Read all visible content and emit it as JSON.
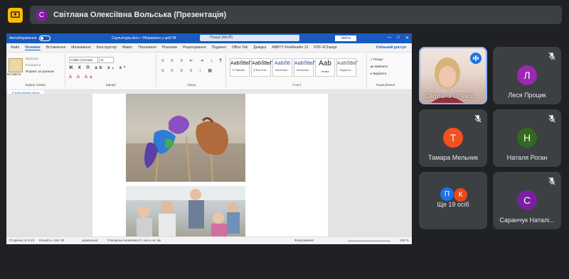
{
  "presenter": {
    "initial": "С",
    "name": "Світлана Олексіївна Вольська (Презентація)"
  },
  "word": {
    "autosave": "Автозбереження",
    "doc_title": "Скульптура.docx • Збережено у цей ПК",
    "search_placeholder": "Пошук (Alt+Й)",
    "signin": "Увійти",
    "tabs": [
      "Файл",
      "Основне",
      "Вставлення",
      "Малювання",
      "Конструктор",
      "Макет",
      "Посилання",
      "Розсилки",
      "Рецензування",
      "Подання",
      "Office Tab",
      "Довідка",
      "ABBYY FineReader 12",
      "PDF-XChange"
    ],
    "active_tab": "Основне",
    "share": "Спільний доступ",
    "groups": [
      "Буфер обміну",
      "Шрифт",
      "Абзац",
      "Стилі",
      "Редагування"
    ],
    "paste": "Вставити",
    "clip_items": [
      "Вирізати",
      "Копіювати",
      "Формат за зразком"
    ],
    "font_name": "Calibri (Основн",
    "font_size": "11",
    "styles": [
      {
        "sample": "АаБбВвГ",
        "name": "¶ Звичай..."
      },
      {
        "sample": "АаБбВвГ",
        "name": "¶ Без інте..."
      },
      {
        "sample": "АаБбВ",
        "name": "Заголово..."
      },
      {
        "sample": "АаБбВвГ",
        "name": "Заголово..."
      },
      {
        "sample": "Aab",
        "name": "Назва"
      },
      {
        "sample": "АаБбВвГ",
        "name": "Підзагол..."
      }
    ],
    "editing": [
      "Пошук",
      "Замінити",
      "Виділити"
    ],
    "doc_tab": "Скульптура.docx",
    "status": {
      "page": "Сторінка 10 із 10",
      "words": "Кількість слів: 30",
      "lang": "українська",
      "access": "Спеціальні можливості: шось не так",
      "focus": "Фокусування",
      "zoom": "100 %"
    }
  },
  "participants": [
    {
      "name": "Світлана Олексі...",
      "type": "camera"
    },
    {
      "name": "Леся Процик",
      "initial": "Л",
      "color": "#9c27b0"
    },
    {
      "name": "Тамара Мельник",
      "initial": "Т",
      "color": "#f4511e"
    },
    {
      "name": "Наталя Роган",
      "initial": "Н",
      "color": "#33691e"
    },
    {
      "name": "Ще 19 осіб",
      "initials": [
        "П",
        "К"
      ],
      "colors": [
        "#1a73e8",
        "#e64a19"
      ]
    },
    {
      "name": "Саранчук Наталі...",
      "initial": "С",
      "color": "#7b1fa2"
    }
  ]
}
